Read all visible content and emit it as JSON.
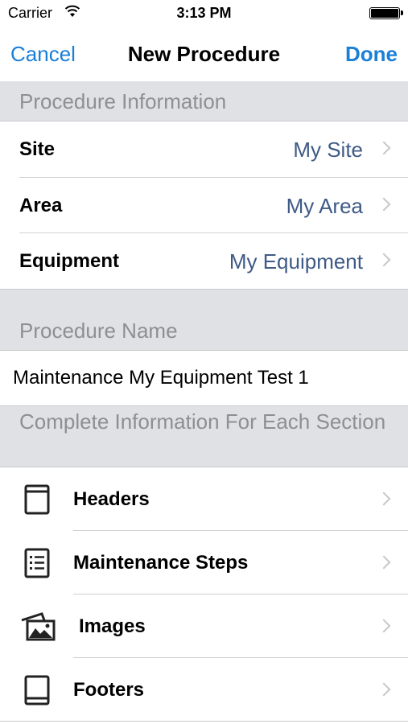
{
  "status_bar": {
    "carrier": "Carrier",
    "time": "3:13 PM"
  },
  "nav": {
    "cancel": "Cancel",
    "title": "New Procedure",
    "done": "Done"
  },
  "sections": {
    "procedure_information": "Procedure Information",
    "procedure_name": "Procedure Name",
    "complete_info": "Complete Information For Each Section"
  },
  "info_rows": [
    {
      "label": "Site",
      "value": "My Site"
    },
    {
      "label": "Area",
      "value": "My Area"
    },
    {
      "label": "Equipment",
      "value": "My Equipment"
    }
  ],
  "procedure_name_value": "Maintenance My Equipment Test 1",
  "section_rows": [
    {
      "label": "Headers",
      "icon": "header-page-icon"
    },
    {
      "label": "Maintenance Steps",
      "icon": "list-icon"
    },
    {
      "label": "Images",
      "icon": "images-icon"
    },
    {
      "label": "Footers",
      "icon": "footer-page-icon"
    }
  ],
  "colors": {
    "accent": "#1a7fd8",
    "value_text": "#3f5a86",
    "section_bg": "#dfe1e5",
    "section_text": "#8c8f94"
  }
}
